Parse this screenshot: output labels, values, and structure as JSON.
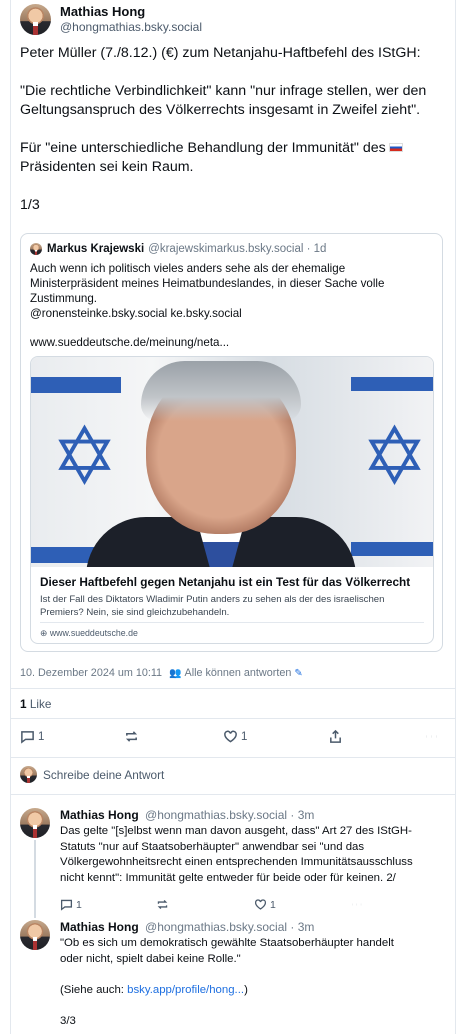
{
  "main_post": {
    "author": {
      "display_name": "Mathias Hong",
      "handle": "@hongmathias.bsky.social"
    },
    "text": {
      "p1": "Peter Müller (7./8.12.) (€) zum Netanjahu-Haftbefehl des IStGH:",
      "p2": "\"Die rechtliche Verbindlichkeit\" kann \"nur infrage stellen, wer den Geltungsanspruch des Völkerrechts insgesamt in Zweifel zieht\".",
      "p3": "Für \"eine unterschiedliche Behandlung der Immunität\" des",
      "p3_end": "Präsidenten sei kein Raum.",
      "p4": "1/3"
    },
    "quote": {
      "author": "Markus Krajewski",
      "handle": "@krajewskimarkus.bsky.social",
      "time": "· 1d",
      "text_l1": "Auch wenn ich politisch vieles anders sehe als der ehemalige",
      "text_l2": "Ministerpräsident meines Heimatbundeslandes, in dieser Sache volle",
      "text_l3": "Zustimmung.",
      "text_l4": "@ronensteinke.bsky.social ke.bsky.social",
      "link": "www.sueddeutsche.de/meinung/neta...",
      "card": {
        "title": "Dieser Haftbefehl gegen Netanjahu ist ein Test für das Völkerrecht",
        "description": "Ist der Fall des Diktators Wladimir Putin anders zu sehen als der des israelischen Premiers? Nein, sie sind gleichzubehandeln.",
        "domain": "www.sueddeutsche.de"
      }
    },
    "timestamp": "10. Dezember 2024 um 10:11",
    "reply_setting": "Alle können antworten",
    "likes_count": "1",
    "likes_label": "Like",
    "actions": {
      "reply_count": "1",
      "repost_count": "",
      "like_count": "1"
    }
  },
  "compose": {
    "placeholder": "Schreibe deine Antwort"
  },
  "replies": [
    {
      "display_name": "Mathias Hong",
      "handle": "@hongmathias.bsky.social",
      "time": "· 3m",
      "l1": "Das gelte \"[s]elbst wenn man davon ausgeht, dass\" Art 27 des IStGH-",
      "l2": "Statuts \"nur auf Staatsoberhäupter\" anwendbar sei \"und das",
      "l3": "Völkergewohnheitsrecht einen entsprechenden Immunitätsausschluss",
      "l4": "nicht kennt\": Immunität gelte entweder für beide oder für keinen.  2/",
      "reply_count": "1",
      "like_count": "1"
    },
    {
      "display_name": "Mathias Hong",
      "handle": "@hongmathias.bsky.social",
      "time": "· 3m",
      "l1": "\"Ob es sich um demokratisch gewählte Staatsoberhäupter handelt",
      "l2": "oder nicht, spielt dabei keine Rolle.\"",
      "l3_prefix": "(Siehe auch: ",
      "l3_link": "bsky.app/profile/hong...",
      "l3_suffix": ")",
      "l4": "3/3"
    }
  ],
  "icons": {
    "reply": "reply-bubble-icon",
    "repost": "repost-icon",
    "like": "heart-icon",
    "share": "share-icon",
    "more": "more-dots-icon"
  },
  "colors": {
    "link": "#1e6fe0",
    "muted": "#6b7886",
    "border": "#e3e8ee"
  }
}
